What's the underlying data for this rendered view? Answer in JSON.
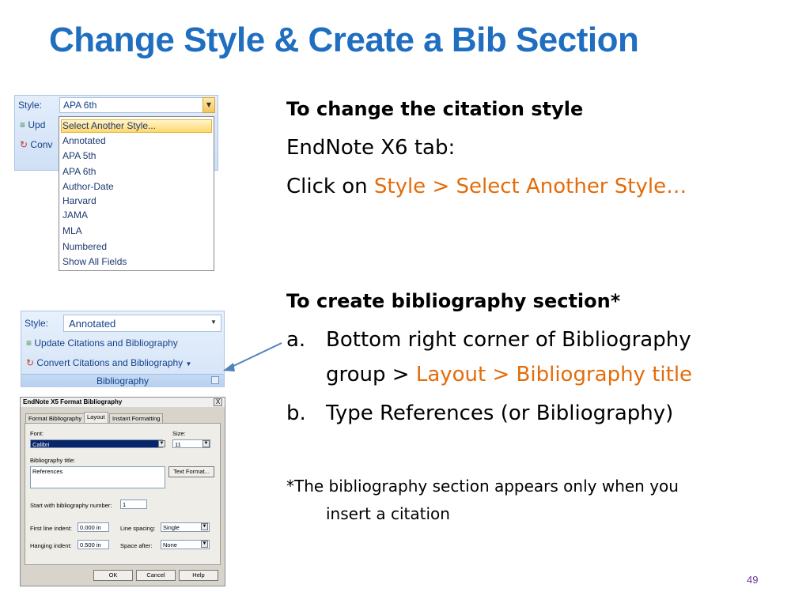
{
  "slide": {
    "title": "Change Style & Create a Bib Section",
    "page_number": "49",
    "section1": {
      "heading": "To change the citation style",
      "line1": "EndNote X6 tab:",
      "line2_prefix": "Click on ",
      "line2_highlight": "Style > Select Another Style…"
    },
    "section2": {
      "heading": "To create bibliography section*",
      "item_a_marker": "a.",
      "item_a_line1": "Bottom right corner of Bibliography",
      "item_a_line2_prefix": "group > ",
      "item_a_line2_highlight": "Layout > Bibliography title",
      "item_b_marker": "b.",
      "item_b_text": "Type References (or Bibliography)",
      "footnote_line1": "*The bibliography section appears only when  you",
      "footnote_line2": "insert a citation"
    },
    "colors": {
      "title": "#1f6ec0",
      "highlight": "#e36c0a",
      "arrow": "#4f81bd"
    }
  },
  "screenshot1": {
    "style_label": "Style:",
    "style_value": "APA 6th",
    "row1_label": "Upd",
    "row2_label": "Conv",
    "options": [
      "Select Another Style...",
      "Annotated",
      "APA 5th",
      "APA 6th",
      "Author-Date",
      "Harvard",
      "JAMA",
      "MLA",
      "Numbered",
      "Show All Fields"
    ]
  },
  "screenshot2": {
    "style_label": "Style:",
    "style_value": "Annotated",
    "update_label": "Update Citations and Bibliography",
    "convert_label": "Convert Citations and Bibliography",
    "group_label": "Bibliography",
    "icons": [
      "update-icon",
      "convert-icon",
      "dialog-launcher-icon"
    ]
  },
  "screenshot3": {
    "title": "EndNote X5 Format Bibliography",
    "close": "X",
    "tabs": [
      "Format Bibliography",
      "Layout",
      "Instant Formatting"
    ],
    "font_label": "Font:",
    "font_value": "Calibri",
    "size_label": "Size:",
    "size_value": "11",
    "bib_title_label": "Bibliography title:",
    "bib_title_value": "References",
    "text_format_button": "Text Format...",
    "start_label": "Start with bibliography number:",
    "start_value": "1",
    "first_indent_label": "First line indent:",
    "first_indent_value": "0.000 in",
    "line_spacing_label": "Line spacing:",
    "line_spacing_value": "Single",
    "hanging_label": "Hanging indent:",
    "hanging_value": "0.500 in",
    "space_after_label": "Space after:",
    "space_after_value": "None",
    "ok": "OK",
    "cancel": "Cancel",
    "help": "Help"
  }
}
